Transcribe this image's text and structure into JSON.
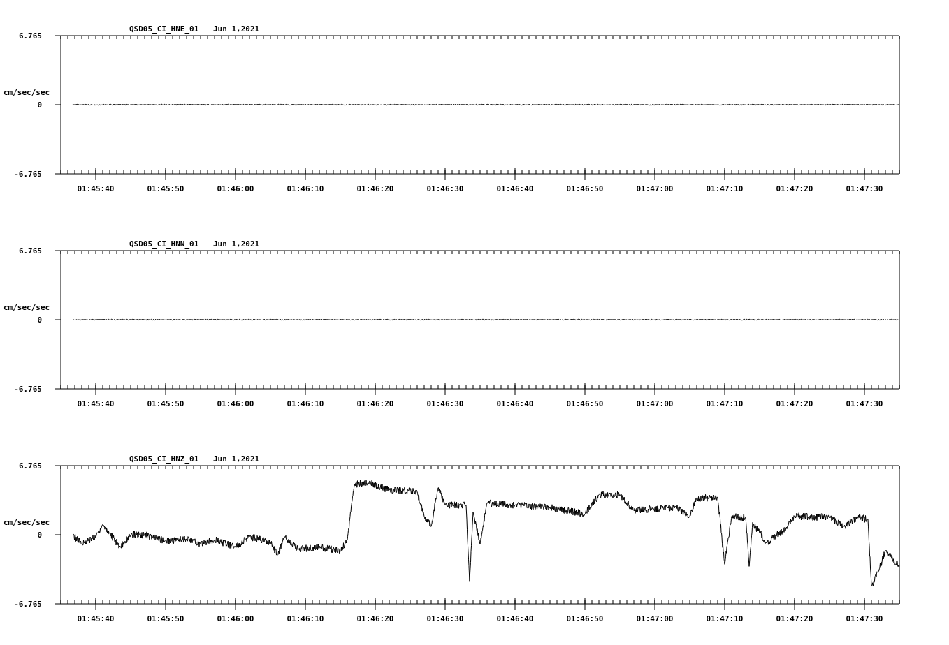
{
  "charts": [
    {
      "station": "QSD05_CI_HNE_01",
      "date": "Jun 1,2021",
      "ylabel": "cm/sec/sec",
      "chart_data": {
        "type": "line",
        "xlim": [
          6335,
          6455
        ],
        "ylim": [
          -6.765,
          6.765
        ],
        "yticks": [
          {
            "value": 6.765,
            "label": "6.765"
          },
          {
            "value": 0,
            "label": "0"
          },
          {
            "value": -6.765,
            "label": "-6.765"
          }
        ],
        "xticks": [
          {
            "value": 6340,
            "label": "01:45:40"
          },
          {
            "value": 6350,
            "label": "01:45:50"
          },
          {
            "value": 6360,
            "label": "01:46:00"
          },
          {
            "value": 6370,
            "label": "01:46:10"
          },
          {
            "value": 6380,
            "label": "01:46:20"
          },
          {
            "value": 6390,
            "label": "01:46:30"
          },
          {
            "value": 6400,
            "label": "01:46:40"
          },
          {
            "value": 6410,
            "label": "01:46:50"
          },
          {
            "value": 6420,
            "label": "01:47:00"
          },
          {
            "value": 6430,
            "label": "01:47:10"
          },
          {
            "value": 6440,
            "label": "01:47:20"
          },
          {
            "value": 6450,
            "label": "01:47:30"
          }
        ],
        "x": [
          6336.7,
          6455
        ],
        "series": [
          {
            "color": "#000000",
            "values": [
              0,
              0
            ]
          }
        ]
      }
    },
    {
      "station": "QSD05_CI_HNN_01",
      "date": "Jun 1,2021",
      "ylabel": "cm/sec/sec",
      "chart_data": {
        "type": "line",
        "xlim": [
          6335,
          6455
        ],
        "ylim": [
          -6.765,
          6.765
        ],
        "yticks": [
          {
            "value": 6.765,
            "label": "6.765"
          },
          {
            "value": 0,
            "label": "0"
          },
          {
            "value": -6.765,
            "label": "-6.765"
          }
        ],
        "xticks": [
          {
            "value": 6340,
            "label": "01:45:40"
          },
          {
            "value": 6350,
            "label": "01:45:50"
          },
          {
            "value": 6360,
            "label": "01:46:00"
          },
          {
            "value": 6370,
            "label": "01:46:10"
          },
          {
            "value": 6380,
            "label": "01:46:20"
          },
          {
            "value": 6390,
            "label": "01:46:30"
          },
          {
            "value": 6400,
            "label": "01:46:40"
          },
          {
            "value": 6410,
            "label": "01:46:50"
          },
          {
            "value": 6420,
            "label": "01:47:00"
          },
          {
            "value": 6430,
            "label": "01:47:10"
          },
          {
            "value": 6440,
            "label": "01:47:20"
          },
          {
            "value": 6450,
            "label": "01:47:30"
          }
        ],
        "x": [
          6336.7,
          6455
        ],
        "series": [
          {
            "color": "#000000",
            "values": [
              0,
              0
            ]
          }
        ]
      }
    },
    {
      "station": "QSD05_CI_HNZ_01",
      "date": "Jun 1,2021",
      "ylabel": "cm/sec/sec",
      "chart_data": {
        "type": "line",
        "xlim": [
          6335,
          6455
        ],
        "ylim": [
          -6.765,
          6.765
        ],
        "yticks": [
          {
            "value": 6.765,
            "label": "6.765"
          },
          {
            "value": 0,
            "label": "0"
          },
          {
            "value": -6.765,
            "label": "-6.765"
          }
        ],
        "xticks": [
          {
            "value": 6340,
            "label": "01:45:40"
          },
          {
            "value": 6350,
            "label": "01:45:50"
          },
          {
            "value": 6360,
            "label": "01:46:00"
          },
          {
            "value": 6370,
            "label": "01:46:10"
          },
          {
            "value": 6380,
            "label": "01:46:20"
          },
          {
            "value": 6390,
            "label": "01:46:30"
          },
          {
            "value": 6400,
            "label": "01:46:40"
          },
          {
            "value": 6410,
            "label": "01:46:50"
          },
          {
            "value": 6420,
            "label": "01:47:00"
          },
          {
            "value": 6430,
            "label": "01:47:10"
          },
          {
            "value": 6440,
            "label": "01:47:20"
          },
          {
            "value": 6450,
            "label": "01:47:30"
          }
        ],
        "x": [
          6336.7,
          6338,
          6340,
          6341,
          6342,
          6343.5,
          6345,
          6347,
          6350,
          6353,
          6355,
          6357,
          6360,
          6362,
          6365,
          6366,
          6367,
          6369,
          6372,
          6375,
          6376,
          6377,
          6379,
          6382,
          6386,
          6387,
          6388,
          6389,
          6390,
          6393,
          6393.5,
          6394,
          6395,
          6396,
          6400,
          6405,
          6410,
          6412,
          6415,
          6417,
          6423,
          6425,
          6426,
          6429,
          6430,
          6431,
          6433,
          6433.5,
          6434,
          6436,
          6439,
          6440,
          6445,
          6447,
          6449,
          6450.5,
          6451,
          6452,
          6453,
          6455
        ],
        "series": [
          {
            "color": "#000000",
            "values": [
              0,
              -0.9,
              -0.2,
              1.0,
              0.1,
              -1.2,
              0,
              0,
              -0.6,
              -0.4,
              -0.9,
              -0.5,
              -1.2,
              -0.2,
              -0.7,
              -2.0,
              -0.2,
              -1.4,
              -1.2,
              -1.6,
              -0.5,
              4.9,
              5.1,
              4.4,
              4.2,
              1.8,
              0.8,
              4.6,
              2.9,
              2.9,
              -4.6,
              2.2,
              -0.9,
              3.1,
              2.9,
              2.7,
              2.0,
              3.9,
              3.9,
              2.4,
              2.7,
              1.8,
              3.6,
              3.6,
              -2.9,
              1.8,
              1.7,
              -3.1,
              1.2,
              -0.8,
              0.8,
              1.8,
              1.7,
              0.8,
              1.7,
              1.5,
              -5.0,
              -3.6,
              -1.6,
              -3.1
            ]
          }
        ]
      }
    }
  ]
}
